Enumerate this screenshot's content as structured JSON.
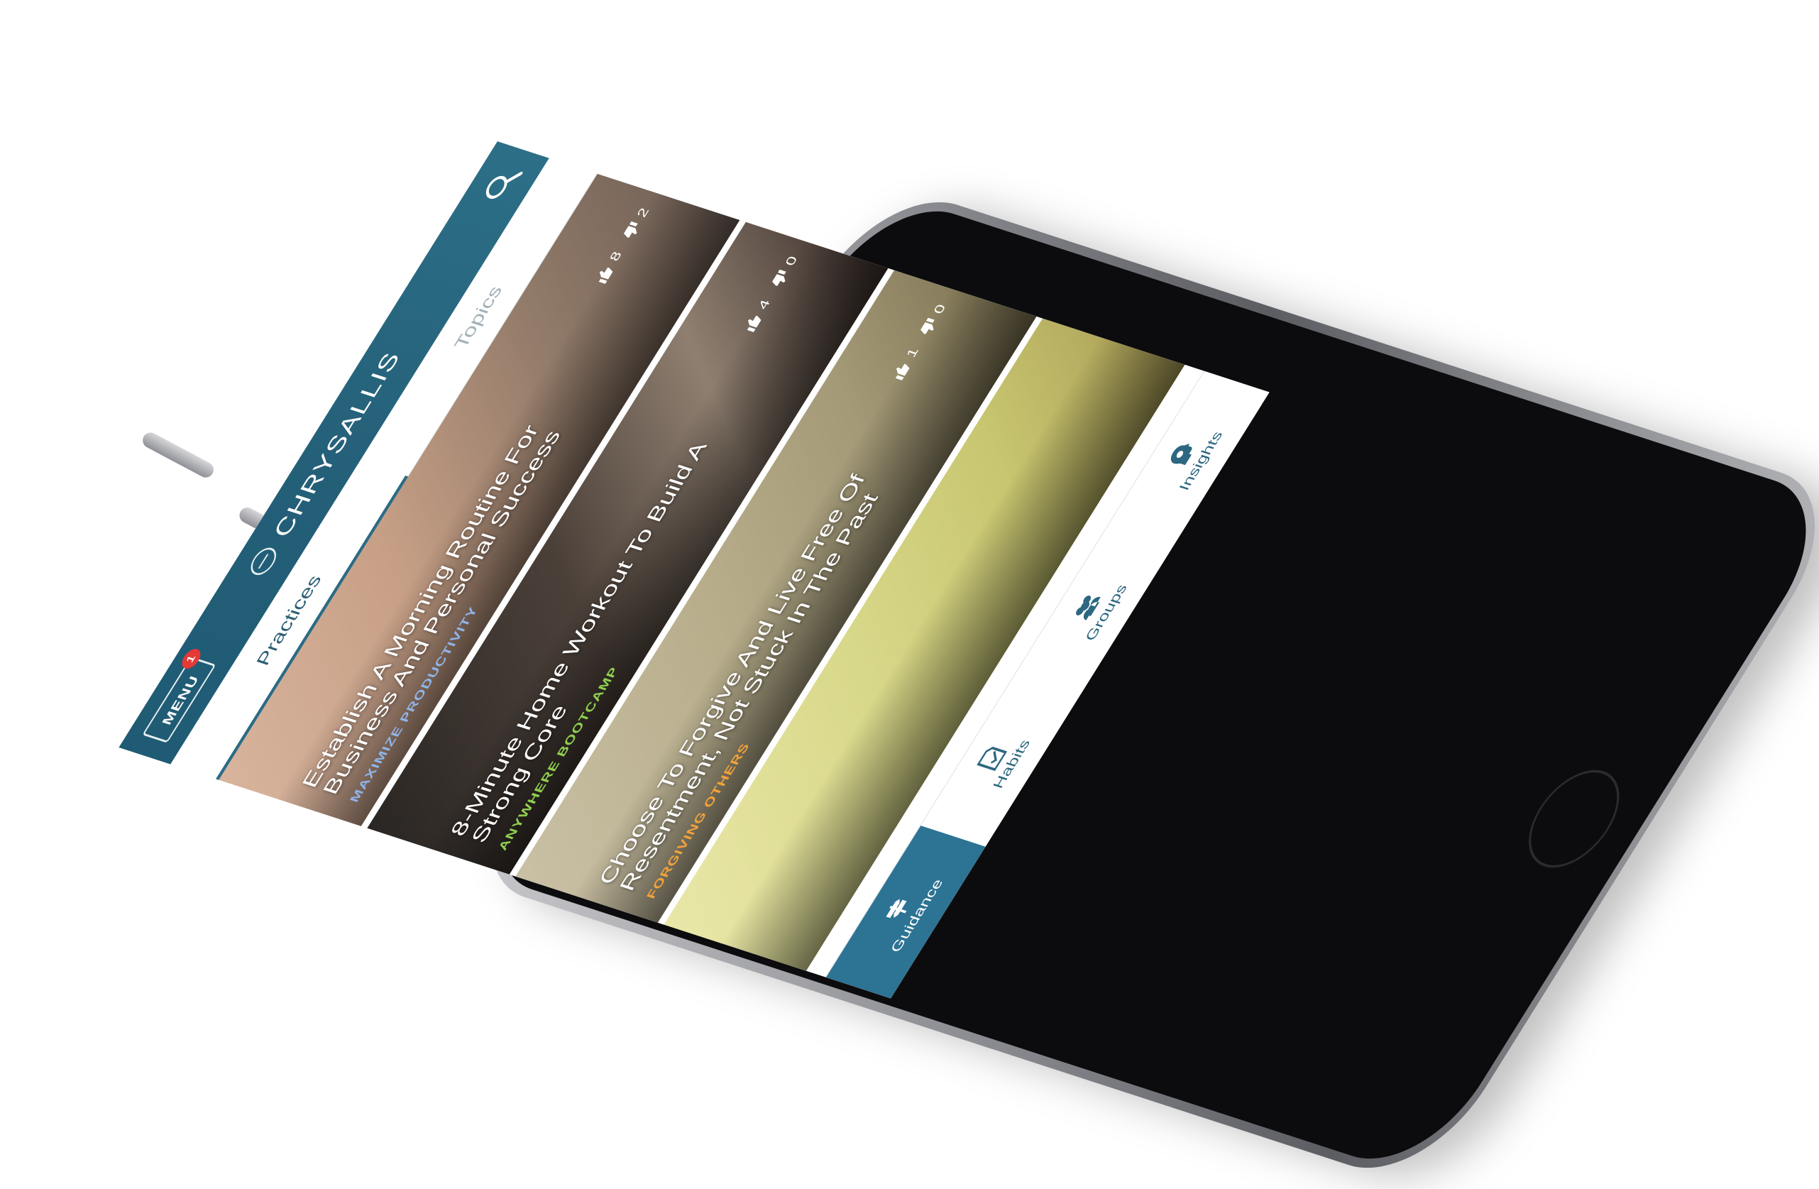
{
  "app": {
    "brand": "CHRYSALLIS",
    "menu_label": "MENU",
    "menu_badge": "1"
  },
  "tabs": [
    {
      "label": "Practices",
      "active": true
    },
    {
      "label": "Topics",
      "active": false
    }
  ],
  "cards": [
    {
      "title": "Establish A Morning Routine For Business And Personal Success",
      "category": "MAXIMIZE PRODUCTIVITY",
      "category_color": "#8fb3e8",
      "likes": "8",
      "dislikes": "2"
    },
    {
      "title": "8-Minute Home Workout To Build A Strong Core",
      "category": "ANYWHERE BOOTCAMP",
      "category_color": "#8fcf4f",
      "likes": "4",
      "dislikes": "0"
    },
    {
      "title": "Choose To Forgive And Live Free Of Resentment, Not Stuck In The Past",
      "category": "FORGIVING OTHERS",
      "category_color": "#f2a23a",
      "likes": "1",
      "dislikes": "0"
    }
  ],
  "bottom_nav": [
    {
      "label": "Guidance",
      "icon": "signpost-icon",
      "active": true
    },
    {
      "label": "Habits",
      "icon": "document-check-icon",
      "active": false
    },
    {
      "label": "Groups",
      "icon": "people-icon",
      "active": false
    },
    {
      "label": "Insights",
      "icon": "head-gear-icon",
      "active": false
    }
  ]
}
